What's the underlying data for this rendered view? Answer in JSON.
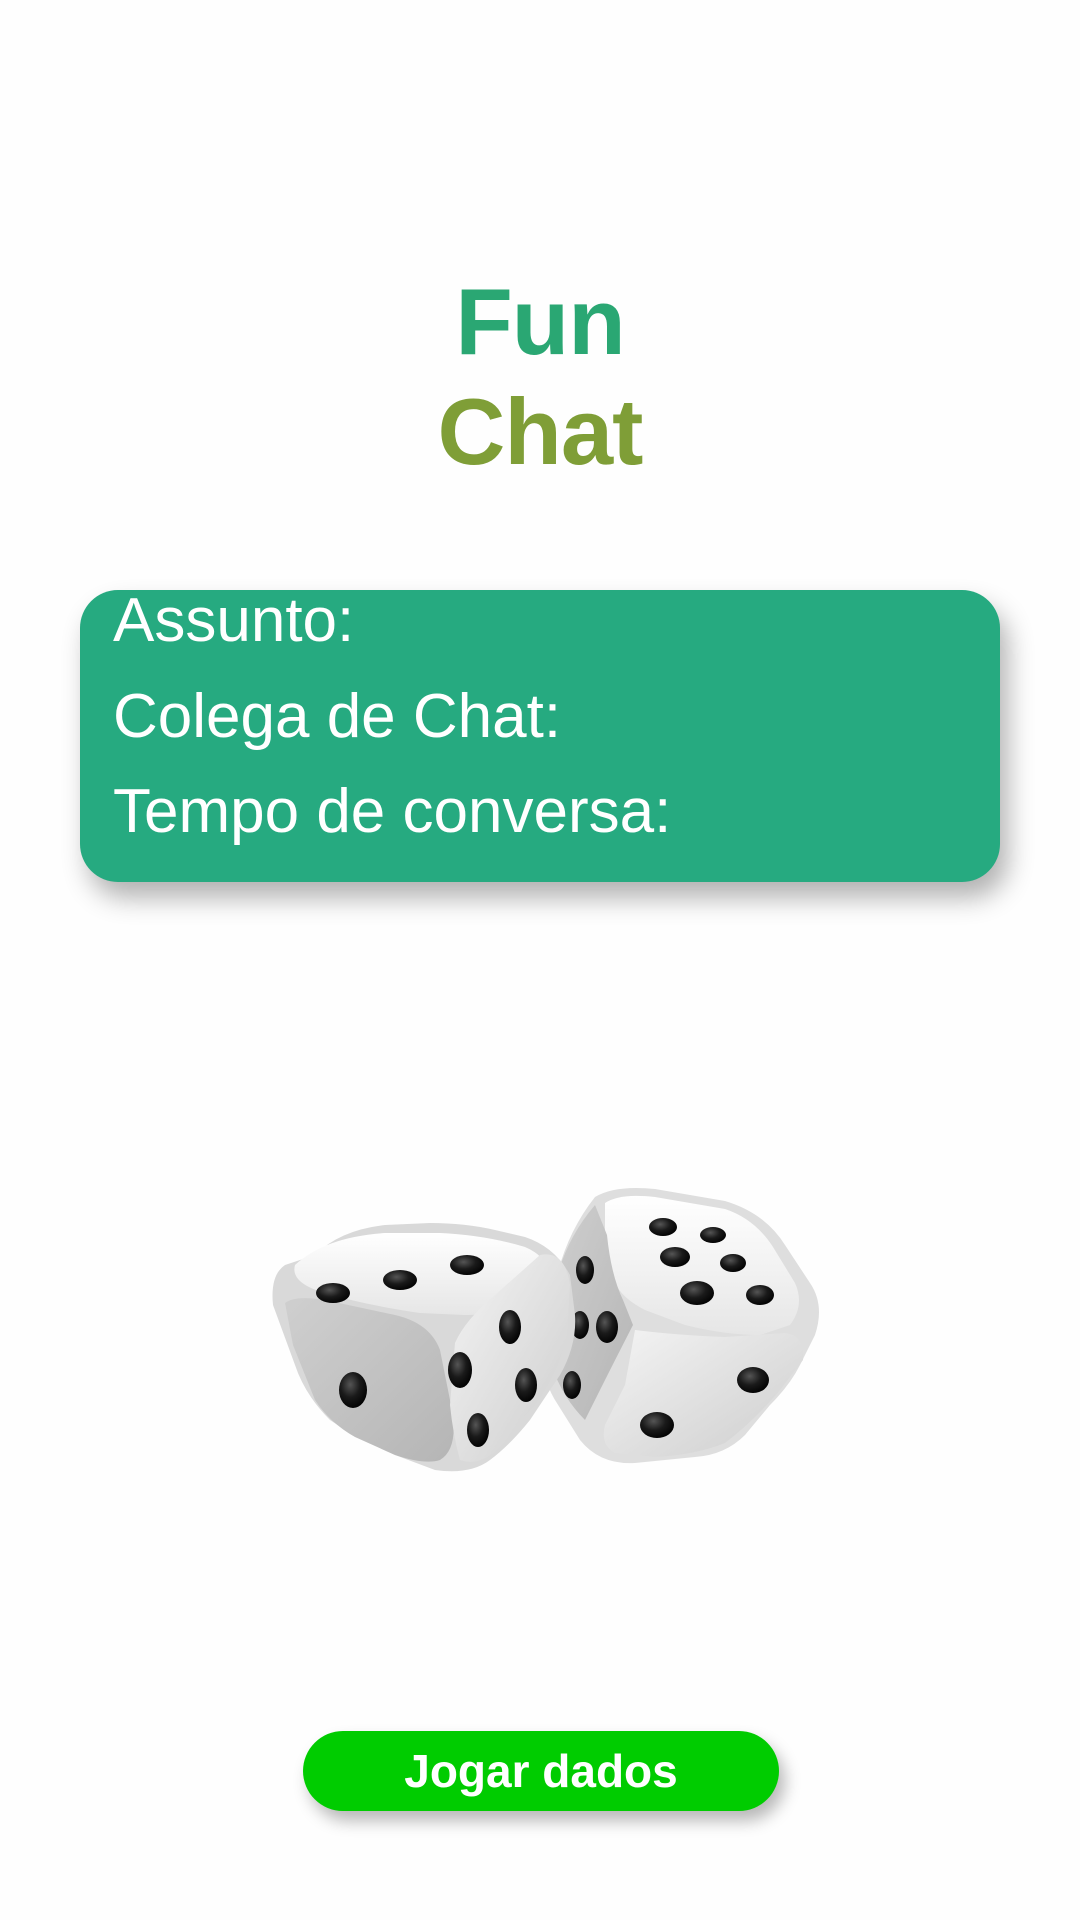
{
  "header": {
    "title_line1": "Fun",
    "title_line2": "Chat",
    "title_line1_color": "#2aa773",
    "title_line2_color": "#7f9e37"
  },
  "info_card": {
    "background": "#26aa80",
    "topic_label": "Assunto:",
    "partner_label": "Colega de Chat:",
    "duration_label": "Tempo de conversa:"
  },
  "dice": {
    "icon": "dice-icon",
    "left_die_faces": [
      3,
      1,
      5
    ],
    "right_die_faces": [
      6,
      2,
      6
    ]
  },
  "actions": {
    "roll_label": "Jogar dados",
    "roll_color": "#00cc00"
  }
}
